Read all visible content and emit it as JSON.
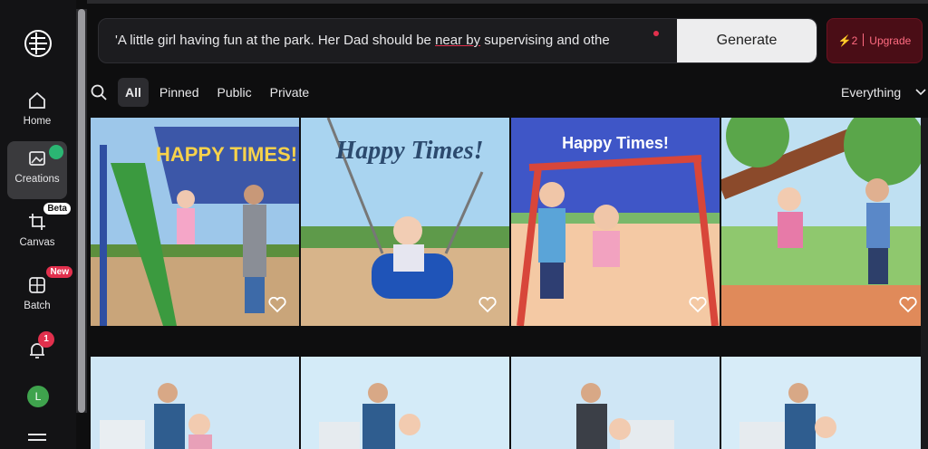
{
  "nav": {
    "home": "Home",
    "creations": "Creations",
    "canvas": "Canvas",
    "canvas_badge": "Beta",
    "batch": "Batch",
    "batch_badge": "New",
    "notifications_count": "1",
    "avatar_letter": "L"
  },
  "prompt": {
    "text_before": "'A little girl having fun at the park. Her Dad should be ",
    "text_underlined": "near by",
    "text_after": " supervising and othe",
    "generate_label": "Generate"
  },
  "upgrade": {
    "credits": "2",
    "label": "Upgrade"
  },
  "filters": {
    "all": "All",
    "pinned": "Pinned",
    "public": "Public",
    "private": "Private",
    "scope": "Everything"
  },
  "tiles": [
    {
      "caption": "HAPPY TIMES!"
    },
    {
      "caption": "Happy Times!"
    },
    {
      "caption": "Happy Times!"
    },
    {
      "caption": ""
    }
  ],
  "colors": {
    "accent_red": "#e2304d",
    "success_green": "#2bb673",
    "upgrade_bg": "#4a0d16"
  }
}
